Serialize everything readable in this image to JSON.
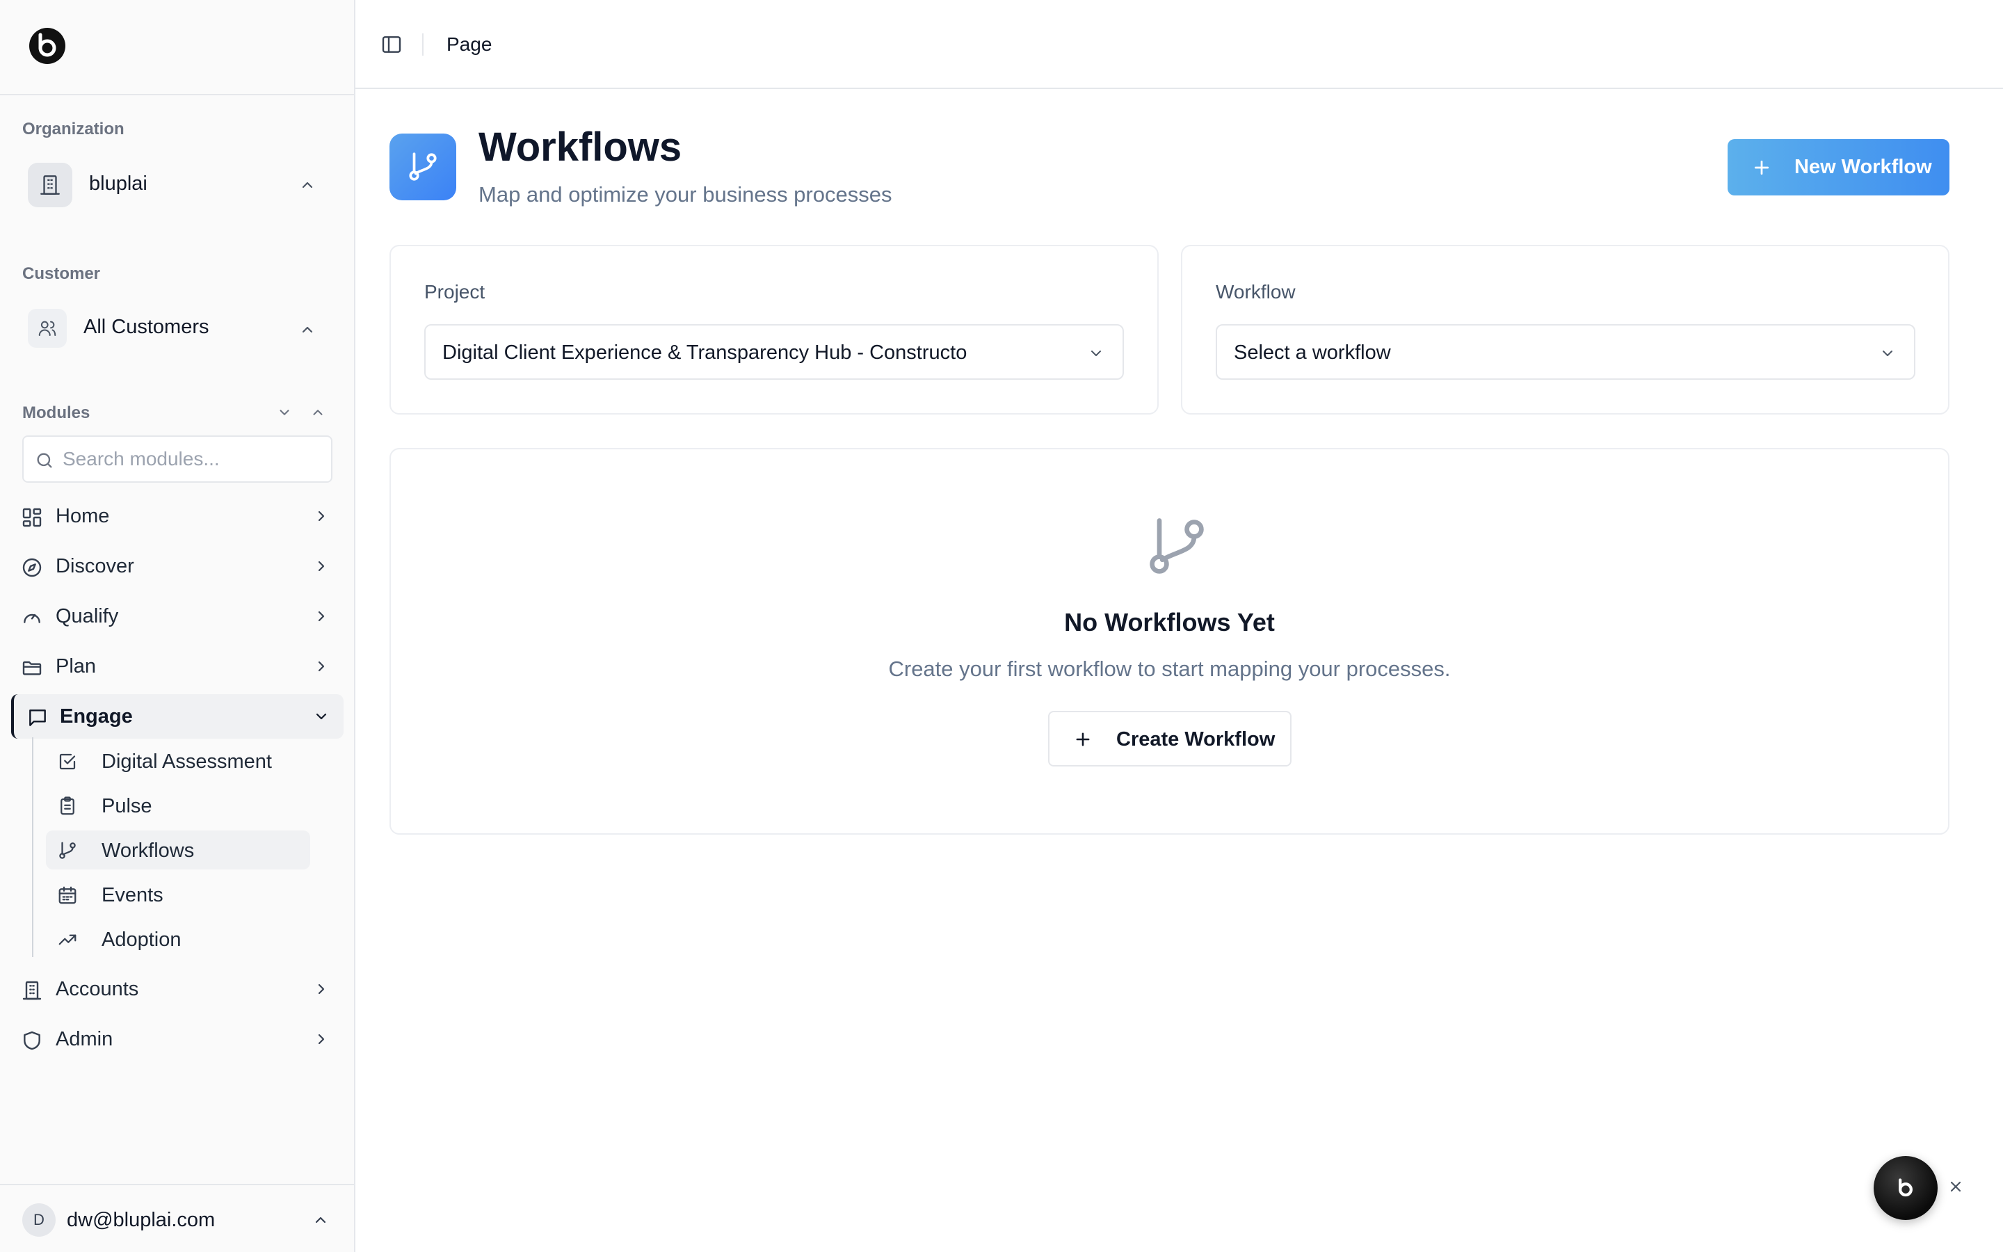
{
  "sidebar": {
    "org_label": "Organization",
    "org_name": "bluplai",
    "customer_label": "Customer",
    "customer_name": "All Customers",
    "modules_label": "Modules",
    "search_placeholder": "Search modules...",
    "nav": [
      {
        "label": "Home",
        "icon": "grid-icon"
      },
      {
        "label": "Discover",
        "icon": "compass-icon"
      },
      {
        "label": "Qualify",
        "icon": "gauge-icon"
      },
      {
        "label": "Plan",
        "icon": "folder-icon"
      },
      {
        "label": "Engage",
        "icon": "message-square-icon",
        "expanded": true
      }
    ],
    "engage_children": [
      {
        "label": "Digital Assessment",
        "icon": "check-square-icon"
      },
      {
        "label": "Pulse",
        "icon": "clipboard-icon"
      },
      {
        "label": "Workflows",
        "icon": "git-branch-icon",
        "active": true
      },
      {
        "label": "Events",
        "icon": "calendar-icon"
      },
      {
        "label": "Adoption",
        "icon": "trending-up-icon"
      }
    ],
    "nav_after": [
      {
        "label": "Accounts",
        "icon": "building-icon"
      },
      {
        "label": "Admin",
        "icon": "shield-icon"
      }
    ],
    "user_initial": "D",
    "user_email": "dw@bluplai.com"
  },
  "topbar": {
    "breadcrumb": "Page"
  },
  "header": {
    "title": "Workflows",
    "subtitle": "Map and optimize your business processes",
    "new_button": "New Workflow"
  },
  "filters": {
    "project_label": "Project",
    "project_value": "Digital Client Experience & Transparency Hub - Constructo",
    "workflow_label": "Workflow",
    "workflow_value": "Select a workflow"
  },
  "empty_state": {
    "title": "No Workflows Yet",
    "description": "Create your first workflow to start mapping your processes.",
    "button": "Create Workflow"
  },
  "colors": {
    "accent_start": "#5cb0ec",
    "accent_end": "#3f8ef0",
    "sidebar_bg": "#fafafa",
    "border": "#e5e7eb"
  }
}
